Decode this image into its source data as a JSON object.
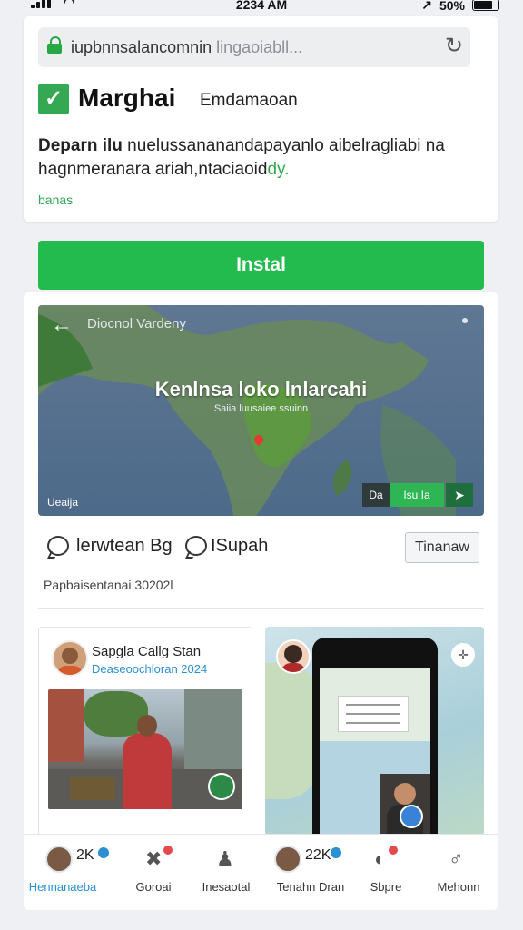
{
  "status_bar": {
    "time": "2234 AM",
    "battery": "50%"
  },
  "browser": {
    "url_main": "iupbnnsalancomnin",
    "url_faded": "lingaoiabll..."
  },
  "brand": {
    "name": "Marghai",
    "subtitle": "Emdamaoan"
  },
  "description": {
    "lead": "Deparn ilu",
    "rest": " nuelussananandapayanlo aibelragliabi na hagnmeranara ariah,ntaciaoid",
    "tail": "dy.",
    "link": "banas"
  },
  "install_label": "Instal",
  "map": {
    "title": "Diocnol Vardeny",
    "headline": "Kenlnsa loko lnlarcahi",
    "subline": "Saiia luusaiee ssuinn",
    "corner_label": "Ueaija",
    "ctrl_a": "Da",
    "ctrl_b": "Isu Ia",
    "ctrl_icon": "navigate-icon"
  },
  "actions": {
    "item1": "lerwtean Bg",
    "item2": "ISupah",
    "button": "Tinanaw"
  },
  "meta_text": "Papbaisentanai 30202l",
  "post1": {
    "name": "Sapgla Callg Stan",
    "subtitle": "Deaseoochloran 2024"
  },
  "bottom_nav": [
    {
      "count": "2K",
      "label": "Hennanaeba",
      "active": true
    },
    {
      "label": "Goroai"
    },
    {
      "label": "Inesaotal"
    },
    {
      "count": "22K",
      "label": "Tenahn Dran"
    },
    {
      "label": "Sbpre"
    },
    {
      "label": "Mehonn"
    }
  ]
}
